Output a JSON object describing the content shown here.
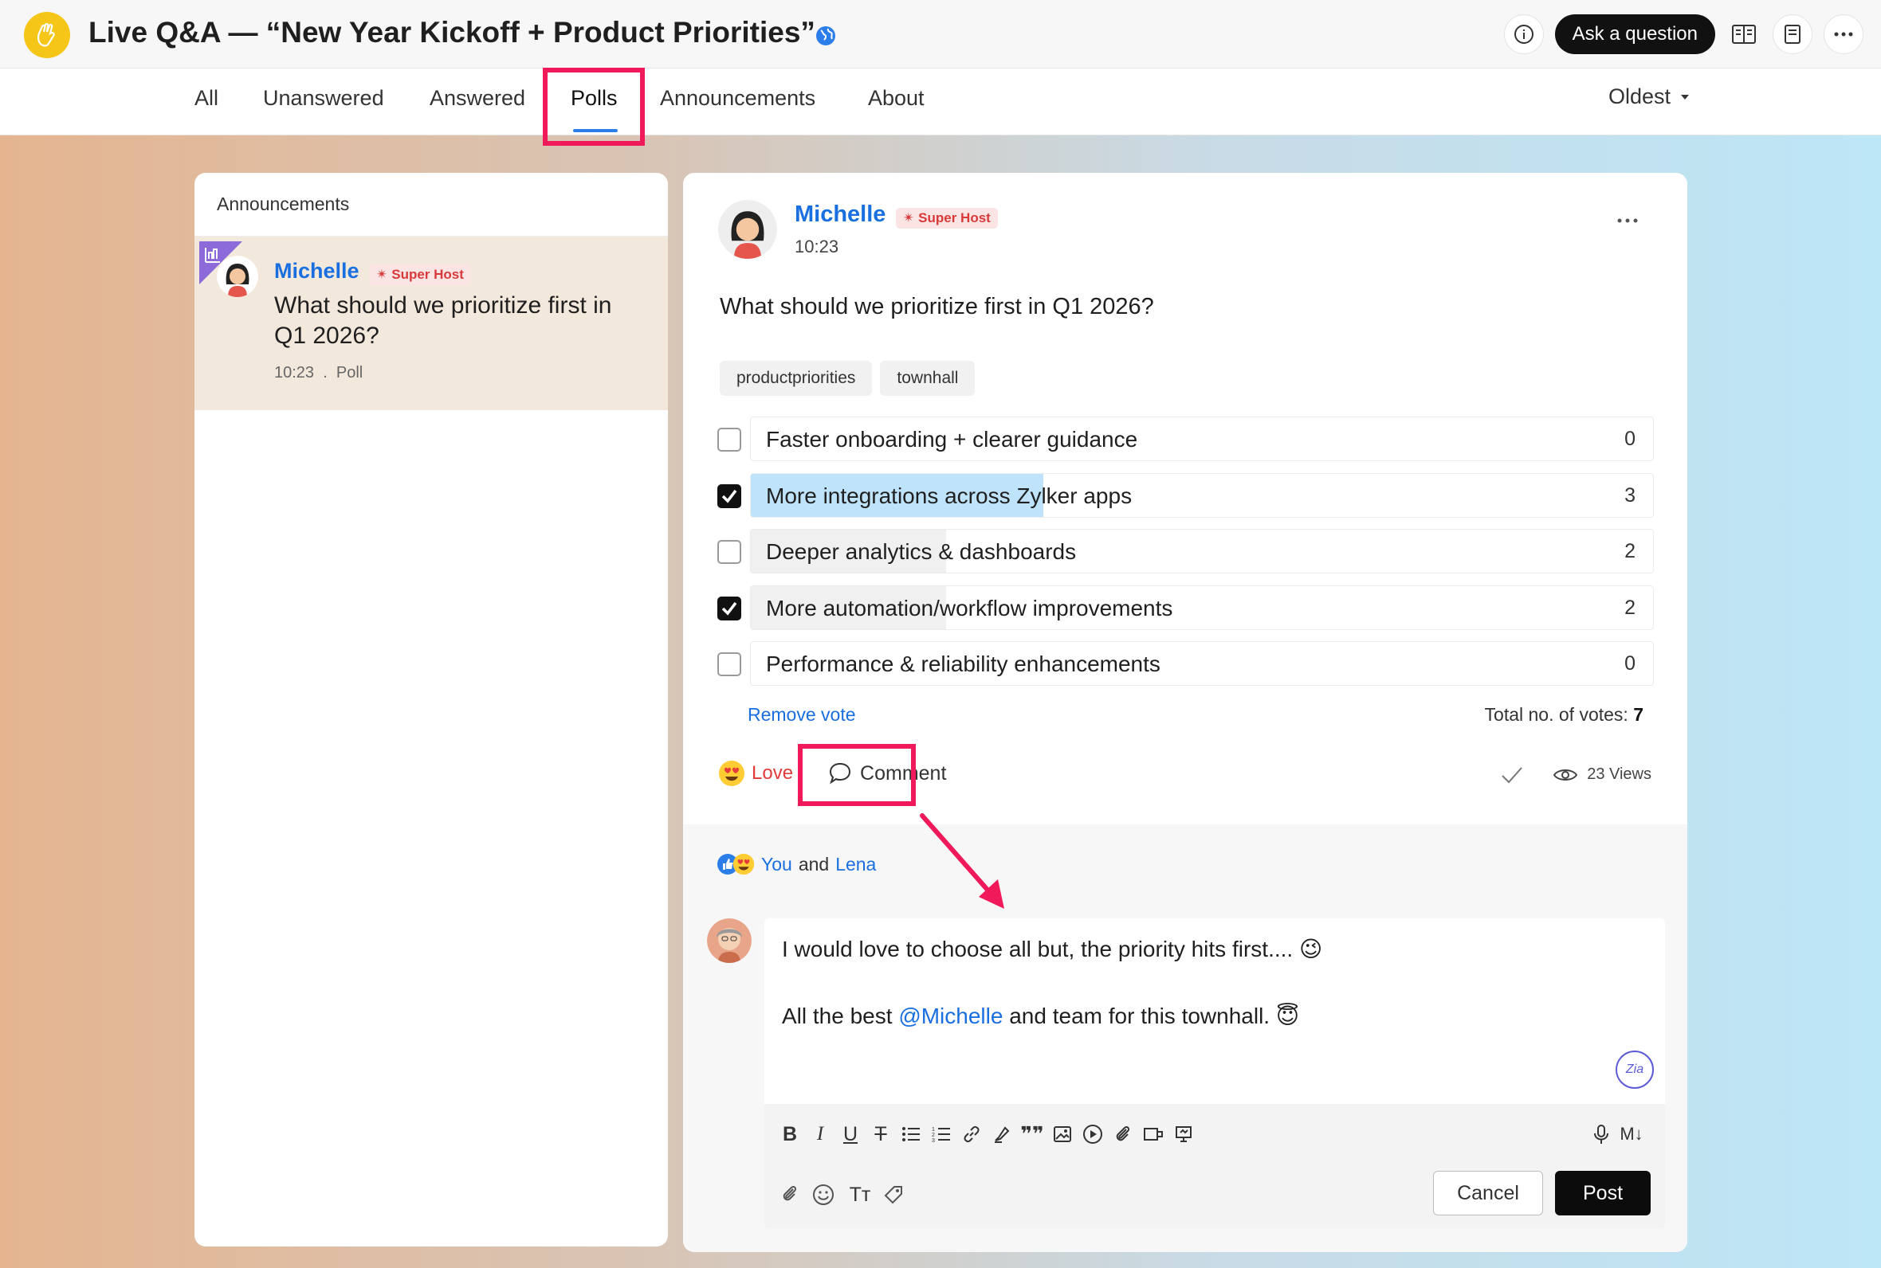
{
  "header": {
    "title": "Live Q&A — “New Year Kickoff + Product Priorities”",
    "ask_label": "Ask a question",
    "icons": [
      "info-icon",
      "reader-view-icon",
      "notes-icon",
      "more-icon"
    ]
  },
  "tabs": [
    "All",
    "Unanswered",
    "Answered",
    "Polls",
    "Announcements",
    "About"
  ],
  "active_tab": "Polls",
  "sort_label": "Oldest",
  "sidebar": {
    "heading": "Announcements",
    "item": {
      "author": "Michelle",
      "badge": "Super Host",
      "question": "What should we prioritize first in Q1 2026?",
      "time": "10:23",
      "separator": ".",
      "type": "Poll"
    }
  },
  "post": {
    "author": "Michelle",
    "badge": "Super Host",
    "time": "10:23",
    "question": "What should we prioritize first in Q1 2026?",
    "tags": [
      "productpriorities",
      "townhall"
    ],
    "options": [
      {
        "label": "Faster onboarding + clearer guidance",
        "count": "0",
        "votes": 0,
        "checked": false
      },
      {
        "label": "More integrations across Zylker apps",
        "count": "3",
        "votes": 3,
        "checked": true
      },
      {
        "label": "Deeper analytics & dashboards",
        "count": "2",
        "votes": 2,
        "checked": false
      },
      {
        "label": "More automation/workflow improvements",
        "count": "2",
        "votes": 2,
        "checked": true
      },
      {
        "label": "Performance & reliability enhancements",
        "count": "0",
        "votes": 0,
        "checked": false
      }
    ],
    "remove_vote": "Remove vote",
    "total_votes_label": "Total no. of votes:",
    "total_votes": "7",
    "love_label": "Love",
    "comment_label": "Comment",
    "views": "23 Views"
  },
  "reactions": {
    "you": "You",
    "and": "and",
    "other": "Lena"
  },
  "editor": {
    "line1": "I would love to choose all but, the priority hits first....",
    "line2_prefix": "All the best",
    "mention": "@Michelle",
    "line2_suffix": "and team for this townhall.",
    "zia_label": "Zia",
    "cancel_label": "Cancel",
    "post_label": "Post",
    "tools": [
      "B",
      "I",
      "U",
      "T",
      "M↓",
      "Tт"
    ]
  },
  "colors": {
    "accent": "#1a6fe0",
    "highlight": "#f0195a",
    "selected_bar": "#bfe3fb",
    "voted_bar": "#f0f0f0",
    "badge_bg": "#fbe4e4"
  }
}
